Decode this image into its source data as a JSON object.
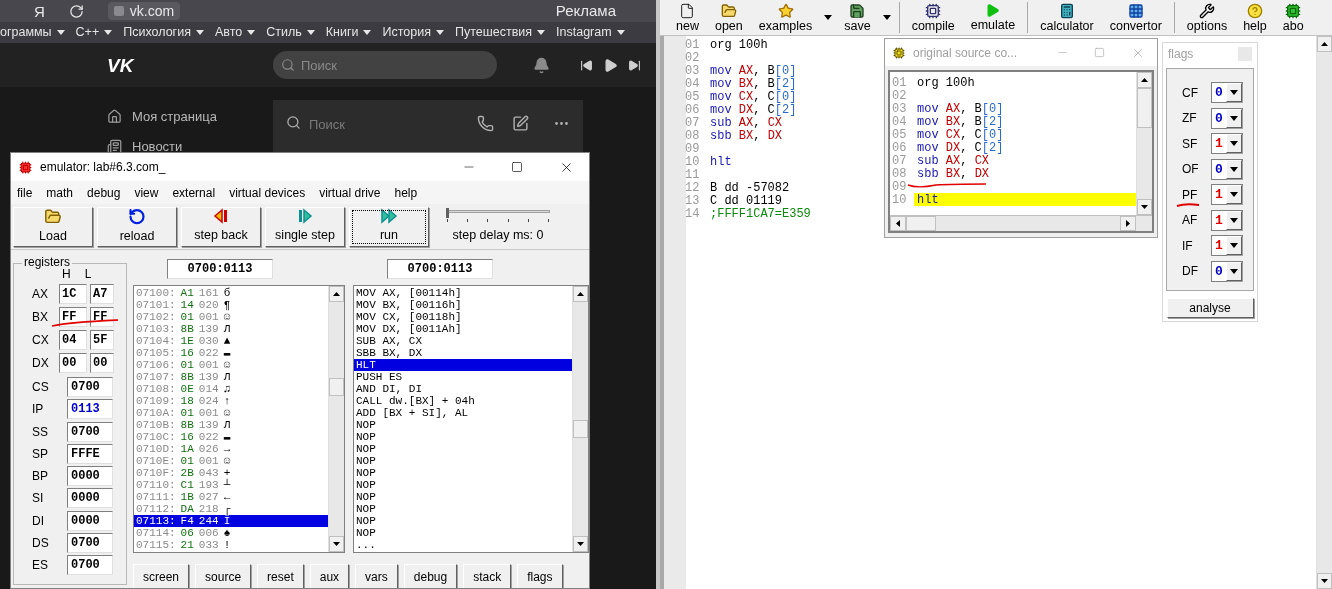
{
  "browser": {
    "yandex_logo": "Я",
    "address": "vk.com",
    "ad_label": "Реклама",
    "bookmarks": [
      {
        "label": "ограммы"
      },
      {
        "label": "C++"
      },
      {
        "label": "Психология"
      },
      {
        "label": "Авто"
      },
      {
        "label": "Стиль"
      },
      {
        "label": "Книги"
      },
      {
        "label": "История"
      },
      {
        "label": "Путешествия"
      },
      {
        "label": "Instagram"
      }
    ],
    "vk": {
      "logo": "VK",
      "search": {
        "placeholder": "Поиск"
      },
      "menu": [
        {
          "label": "Моя страница"
        },
        {
          "label": "Новости"
        }
      ],
      "messages_search": {
        "placeholder": "Поиск"
      }
    }
  },
  "emulator": {
    "title": "emulator: lab#6.3.com_",
    "menu": [
      "file",
      "math",
      "debug",
      "view",
      "external",
      "virtual devices",
      "virtual drive",
      "help"
    ],
    "toolbar": [
      {
        "label": "Load",
        "focused": false
      },
      {
        "label": "reload",
        "focused": false
      },
      {
        "label": "step back",
        "focused": false
      },
      {
        "label": "single step",
        "focused": false
      },
      {
        "label": "run",
        "focused": true
      }
    ],
    "step_delay": {
      "label": "step delay ms: 0",
      "level": 0
    },
    "registers": {
      "title": "registers",
      "col_h": "H",
      "col_l": "L",
      "split": [
        {
          "name": "AX",
          "h": "1C",
          "l": "A7"
        },
        {
          "name": "BX",
          "h": "FF",
          "l": "FF"
        },
        {
          "name": "CX",
          "h": "04",
          "l": "5F"
        },
        {
          "name": "DX",
          "h": "00",
          "l": "00"
        }
      ],
      "full": [
        {
          "name": "CS",
          "value": "0700",
          "changed": false
        },
        {
          "name": "IP",
          "value": "0113",
          "changed": true
        },
        {
          "name": "SS",
          "value": "0700",
          "changed": false
        },
        {
          "name": "SP",
          "value": "FFFE",
          "changed": false
        },
        {
          "name": "BP",
          "value": "0000",
          "changed": false
        },
        {
          "name": "SI",
          "value": "0000",
          "changed": false
        },
        {
          "name": "DI",
          "value": "0000",
          "changed": false
        },
        {
          "name": "DS",
          "value": "0700",
          "changed": false
        },
        {
          "name": "ES",
          "value": "0700",
          "changed": false
        }
      ]
    },
    "memory": {
      "address": "0700:0113",
      "rows": [
        {
          "addr": "07100:",
          "hex": "A1",
          "dec": "161",
          "char": "б",
          "selected": false
        },
        {
          "addr": "07101:",
          "hex": "14",
          "dec": "020",
          "char": "¶",
          "selected": false
        },
        {
          "addr": "07102:",
          "hex": "01",
          "dec": "001",
          "char": "☺",
          "selected": false
        },
        {
          "addr": "07103:",
          "hex": "8B",
          "dec": "139",
          "char": "Л",
          "selected": false
        },
        {
          "addr": "07104:",
          "hex": "1E",
          "dec": "030",
          "char": "▲",
          "selected": false
        },
        {
          "addr": "07105:",
          "hex": "16",
          "dec": "022",
          "char": "▬",
          "selected": false
        },
        {
          "addr": "07106:",
          "hex": "01",
          "dec": "001",
          "char": "☺",
          "selected": false
        },
        {
          "addr": "07107:",
          "hex": "8B",
          "dec": "139",
          "char": "Л",
          "selected": false
        },
        {
          "addr": "07108:",
          "hex": "0E",
          "dec": "014",
          "char": "♫",
          "selected": false
        },
        {
          "addr": "07109:",
          "hex": "18",
          "dec": "024",
          "char": "↑",
          "selected": false
        },
        {
          "addr": "0710A:",
          "hex": "01",
          "dec": "001",
          "char": "☺",
          "selected": false
        },
        {
          "addr": "0710B:",
          "hex": "8B",
          "dec": "139",
          "char": "Л",
          "selected": false
        },
        {
          "addr": "0710C:",
          "hex": "16",
          "dec": "022",
          "char": "▬",
          "selected": false
        },
        {
          "addr": "0710D:",
          "hex": "1A",
          "dec": "026",
          "char": "→",
          "selected": false
        },
        {
          "addr": "0710E:",
          "hex": "01",
          "dec": "001",
          "char": "☺",
          "selected": false
        },
        {
          "addr": "0710F:",
          "hex": "2B",
          "dec": "043",
          "char": "+",
          "selected": false
        },
        {
          "addr": "07110:",
          "hex": "C1",
          "dec": "193",
          "char": "┴",
          "selected": false
        },
        {
          "addr": "07111:",
          "hex": "1B",
          "dec": "027",
          "char": "←",
          "selected": false
        },
        {
          "addr": "07112:",
          "hex": "DA",
          "dec": "218",
          "char": "┌",
          "selected": false
        },
        {
          "addr": "07113:",
          "hex": "F4",
          "dec": "244",
          "char": "Ї",
          "selected": true
        },
        {
          "addr": "07114:",
          "hex": "06",
          "dec": "006",
          "char": "♠",
          "selected": false
        },
        {
          "addr": "07115:",
          "hex": "21",
          "dec": "033",
          "char": "!",
          "selected": false
        }
      ]
    },
    "disassembly": {
      "address": "0700:0113",
      "rows": [
        {
          "text": "MOV AX, [00114h]",
          "selected": false
        },
        {
          "text": "MOV BX, [00116h]",
          "selected": false
        },
        {
          "text": "MOV CX, [00118h]",
          "selected": false
        },
        {
          "text": "MOV DX, [0011Ah]",
          "selected": false
        },
        {
          "text": "SUB AX, CX",
          "selected": false
        },
        {
          "text": "SBB BX, DX",
          "selected": false
        },
        {
          "text": "HLT",
          "selected": true
        },
        {
          "text": "PUSH ES",
          "selected": false
        },
        {
          "text": "AND DI, DI",
          "selected": false
        },
        {
          "text": "CALL dw.[BX] + 04h",
          "selected": false
        },
        {
          "text": "ADD [BX + SI], AL",
          "selected": false
        },
        {
          "text": "NOP",
          "selected": false
        },
        {
          "text": "NOP",
          "selected": false
        },
        {
          "text": "NOP",
          "selected": false
        },
        {
          "text": "NOP",
          "selected": false
        },
        {
          "text": "NOP",
          "selected": false
        },
        {
          "text": "NOP",
          "selected": false
        },
        {
          "text": "NOP",
          "selected": false
        },
        {
          "text": "NOP",
          "selected": false
        },
        {
          "text": "NOP",
          "selected": false
        },
        {
          "text": "NOP",
          "selected": false
        },
        {
          "text": "...",
          "selected": false
        }
      ]
    },
    "bottom_buttons": [
      "screen",
      "source",
      "reset",
      "aux",
      "vars",
      "debug",
      "stack",
      "flags"
    ]
  },
  "editor": {
    "toolbar": [
      {
        "label": "new",
        "dropdown": false
      },
      {
        "label": "open",
        "dropdown": false
      },
      {
        "label": "examples",
        "dropdown": true
      },
      {
        "label": "save",
        "dropdown": true
      },
      {
        "label": "compile",
        "dropdown": false
      },
      {
        "label": "emulate",
        "dropdown": false
      },
      {
        "label": "calculator",
        "dropdown": false
      },
      {
        "label": "convertor",
        "dropdown": false
      },
      {
        "label": "options",
        "dropdown": false
      },
      {
        "label": "help",
        "dropdown": false
      },
      {
        "label": "abo",
        "dropdown": false
      }
    ],
    "lines": [
      {
        "num": "01",
        "tokens": [
          {
            "text": "org 100h",
            "kind": "plain"
          }
        ]
      },
      {
        "num": "02"
      },
      {
        "num": "03",
        "tokens": [
          {
            "text": "mov ",
            "kind": "keyword"
          },
          {
            "text": "AX",
            "kind": "register"
          },
          {
            "text": ", B",
            "kind": "plain"
          },
          {
            "text": "[0]",
            "kind": "index"
          }
        ]
      },
      {
        "num": "04",
        "tokens": [
          {
            "text": "mov ",
            "kind": "keyword"
          },
          {
            "text": "BX",
            "kind": "register"
          },
          {
            "text": ", B",
            "kind": "plain"
          },
          {
            "text": "[2]",
            "kind": "index"
          }
        ]
      },
      {
        "num": "05",
        "tokens": [
          {
            "text": "mov ",
            "kind": "keyword"
          },
          {
            "text": "CX",
            "kind": "register"
          },
          {
            "text": ", C",
            "kind": "plain"
          },
          {
            "text": "[0]",
            "kind": "index"
          }
        ]
      },
      {
        "num": "06",
        "tokens": [
          {
            "text": "mov ",
            "kind": "keyword"
          },
          {
            "text": "DX",
            "kind": "register"
          },
          {
            "text": ", C",
            "kind": "plain"
          },
          {
            "text": "[2]",
            "kind": "index"
          }
        ]
      },
      {
        "num": "07",
        "tokens": [
          {
            "text": "sub ",
            "kind": "keyword"
          },
          {
            "text": "AX",
            "kind": "register"
          },
          {
            "text": ", ",
            "kind": "plain"
          },
          {
            "text": "CX",
            "kind": "register"
          }
        ]
      },
      {
        "num": "08",
        "tokens": [
          {
            "text": "sbb ",
            "kind": "keyword"
          },
          {
            "text": "BX",
            "kind": "register"
          },
          {
            "text": ", ",
            "kind": "plain"
          },
          {
            "text": "DX",
            "kind": "register"
          }
        ]
      },
      {
        "num": "09"
      },
      {
        "num": "10",
        "tokens": [
          {
            "text": "hlt",
            "kind": "keyword"
          }
        ]
      },
      {
        "num": "11"
      },
      {
        "num": "12",
        "tokens": [
          {
            "text": "B dd -57082",
            "kind": "plain"
          }
        ]
      },
      {
        "num": "13",
        "tokens": [
          {
            "text": "C dd 01119",
            "kind": "plain"
          }
        ]
      },
      {
        "num": "14",
        "tokens": [
          {
            "text": ";FFFF1CA7=E359",
            "kind": "comment"
          }
        ]
      }
    ]
  },
  "source_window": {
    "title": "original source co...",
    "lines": [
      {
        "num": "01",
        "selected": false,
        "tokens": [
          {
            "text": "org 100h",
            "kind": "plain"
          }
        ]
      },
      {
        "num": "02",
        "selected": false
      },
      {
        "num": "03",
        "selected": false,
        "tokens": [
          {
            "text": "mov ",
            "kind": "keyword"
          },
          {
            "text": "AX",
            "kind": "register"
          },
          {
            "text": ", B",
            "kind": "plain"
          },
          {
            "text": "[0]",
            "kind": "index"
          }
        ]
      },
      {
        "num": "04",
        "selected": false,
        "tokens": [
          {
            "text": "mov ",
            "kind": "keyword"
          },
          {
            "text": "BX",
            "kind": "register"
          },
          {
            "text": ", B",
            "kind": "plain"
          },
          {
            "text": "[2]",
            "kind": "index"
          }
        ]
      },
      {
        "num": "05",
        "selected": false,
        "tokens": [
          {
            "text": "mov ",
            "kind": "keyword"
          },
          {
            "text": "CX",
            "kind": "register"
          },
          {
            "text": ", C",
            "kind": "plain"
          },
          {
            "text": "[0]",
            "kind": "index"
          }
        ]
      },
      {
        "num": "06",
        "selected": false,
        "tokens": [
          {
            "text": "mov ",
            "kind": "keyword"
          },
          {
            "text": "DX",
            "kind": "register"
          },
          {
            "text": ", C",
            "kind": "plain"
          },
          {
            "text": "[2]",
            "kind": "index"
          }
        ]
      },
      {
        "num": "07",
        "selected": false,
        "tokens": [
          {
            "text": "sub ",
            "kind": "keyword"
          },
          {
            "text": "AX",
            "kind": "register"
          },
          {
            "text": ", ",
            "kind": "plain"
          },
          {
            "text": "CX",
            "kind": "register"
          }
        ]
      },
      {
        "num": "08",
        "selected": false,
        "tokens": [
          {
            "text": "sbb ",
            "kind": "keyword"
          },
          {
            "text": "BX",
            "kind": "register"
          },
          {
            "text": ", ",
            "kind": "plain"
          },
          {
            "text": "DX",
            "kind": "register"
          }
        ]
      },
      {
        "num": "09",
        "selected": false
      },
      {
        "num": "10",
        "selected": true,
        "tokens": [
          {
            "text": "hlt",
            "kind": "keyword"
          }
        ]
      }
    ]
  },
  "flags_window": {
    "title": "flags",
    "flags": [
      {
        "name": "CF",
        "value": "0",
        "set": false
      },
      {
        "name": "ZF",
        "value": "0",
        "set": false
      },
      {
        "name": "SF",
        "value": "1",
        "set": true
      },
      {
        "name": "OF",
        "value": "0",
        "set": false
      },
      {
        "name": "PF",
        "value": "1",
        "set": true
      },
      {
        "name": "AF",
        "value": "1",
        "set": true
      },
      {
        "name": "IF",
        "value": "1",
        "set": true
      },
      {
        "name": "DF",
        "value": "0",
        "set": false
      }
    ],
    "button": "analyse"
  }
}
